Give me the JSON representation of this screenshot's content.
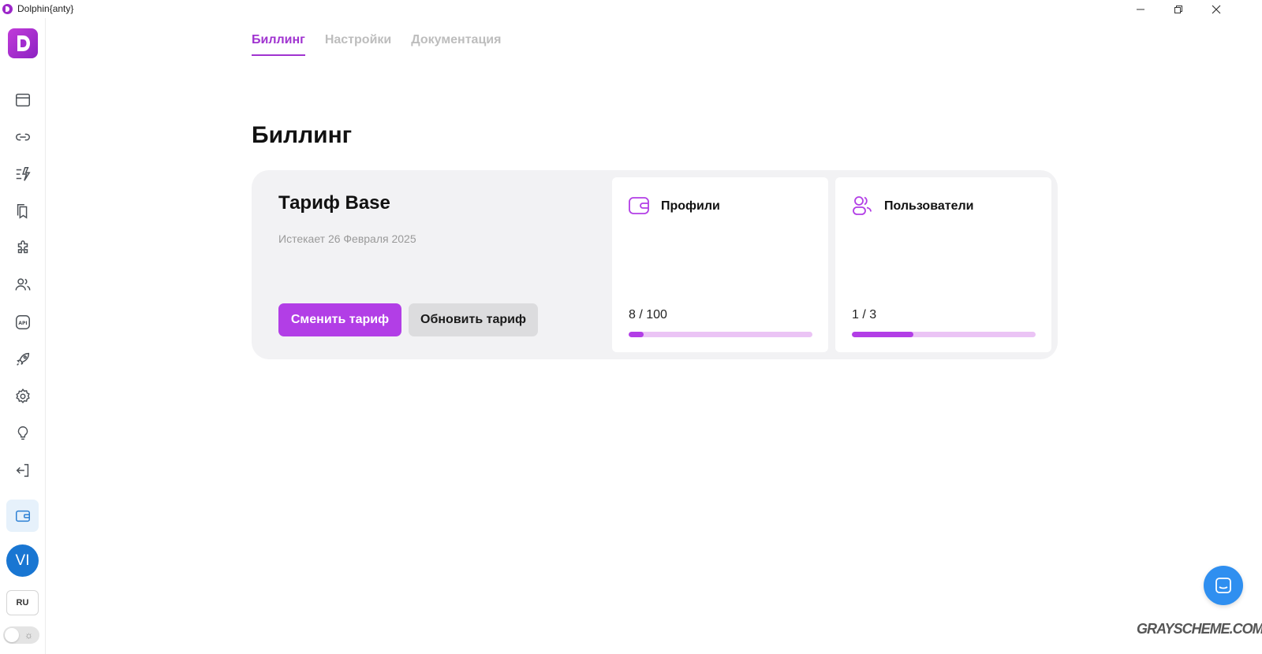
{
  "window": {
    "title": "Dolphin{anty}"
  },
  "sidebar": {
    "logo_letter": "D",
    "items": [
      {
        "name": "browser-profiles",
        "icon": "browser-window-icon"
      },
      {
        "name": "proxies",
        "icon": "link-icon"
      },
      {
        "name": "automation",
        "icon": "flash-list-icon"
      },
      {
        "name": "bookmarks",
        "icon": "bookmarks-icon"
      },
      {
        "name": "extensions",
        "icon": "puzzle-icon"
      },
      {
        "name": "users",
        "icon": "users-icon"
      },
      {
        "name": "api",
        "icon": "api-icon"
      },
      {
        "name": "launch",
        "icon": "rocket-icon"
      },
      {
        "name": "settings",
        "icon": "gear-icon"
      },
      {
        "name": "tips",
        "icon": "lightbulb-icon"
      },
      {
        "name": "logout",
        "icon": "logout-icon"
      },
      {
        "name": "billing",
        "icon": "wallet-icon",
        "active": true
      }
    ],
    "avatar_initials": "VI",
    "language": "RU"
  },
  "tabs": [
    {
      "label": "Биллинг",
      "active": true
    },
    {
      "label": "Настройки",
      "active": false
    },
    {
      "label": "Документация",
      "active": false
    }
  ],
  "page_title": "Биллинг",
  "plan": {
    "name": "Тариф Base",
    "expires": "Истекает 26 Февраля 2025",
    "change_button": "Сменить тариф",
    "renew_button": "Обновить тариф"
  },
  "stats": {
    "profiles": {
      "label": "Профили",
      "count_text": "8 / 100",
      "fraction": 0.08
    },
    "users": {
      "label": "Пользователи",
      "count_text": "1 / 3",
      "fraction": 0.3333
    }
  },
  "watermark": "GRAYSCHEME.COM",
  "colors": {
    "accent": "#b23ee6",
    "active_nav_bg": "#e6f1fb",
    "avatar_bg": "#1976d2",
    "chat_bg": "#2f8ff0"
  }
}
